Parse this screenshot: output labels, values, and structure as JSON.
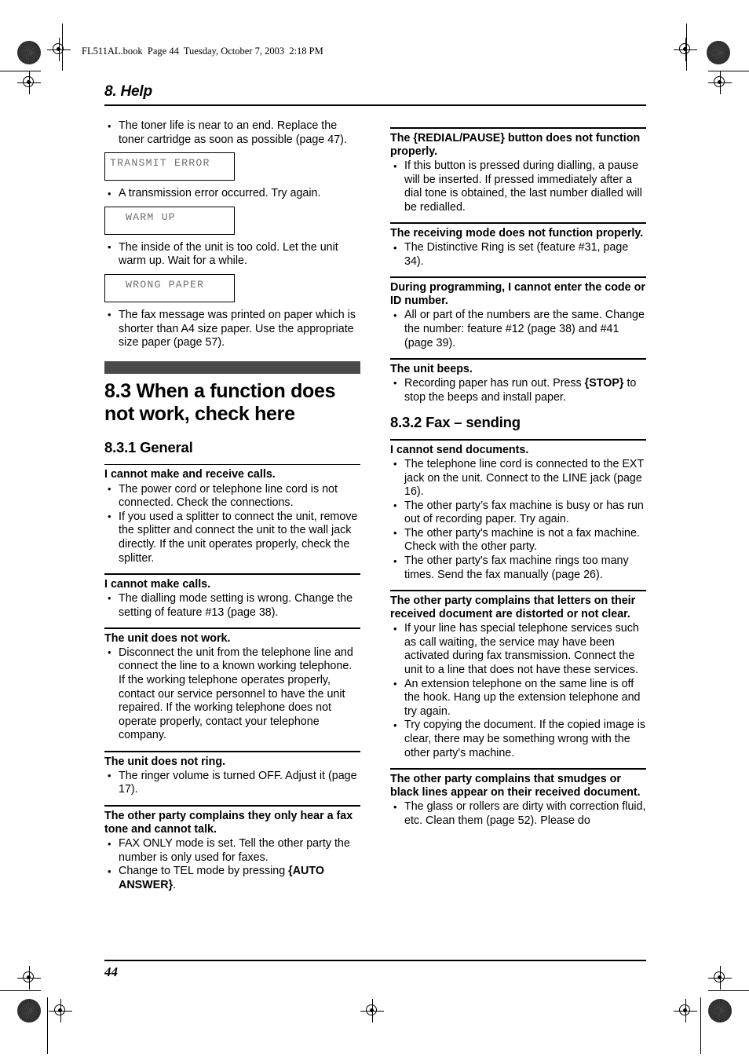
{
  "page": {
    "file_header": "FL511AL.book  Page 44  Tuesday, October 7, 2003  2:18 PM",
    "chapter_title": "8. Help",
    "page_number": "44"
  },
  "left_column": {
    "intro_bullets": [
      "The toner life is near to an end. Replace the toner cartridge as soon as possible (page 47)."
    ],
    "lcd_blocks": [
      {
        "display": "TRANSMIT ERROR",
        "align": "flush",
        "bullets": [
          "A transmission error occurred. Try again."
        ]
      },
      {
        "display": "WARM UP",
        "align": "indent",
        "bullets": [
          "The inside of the unit is too cold. Let the unit warm up. Wait for a while."
        ]
      },
      {
        "display": "WRONG PAPER",
        "align": "indent",
        "bullets": [
          "The fax message was printed on paper which is shorter than A4 size paper. Use the appropriate size paper (page 57)."
        ]
      }
    ],
    "section_heading": "8.3 When a function does not work, check here",
    "subsection_heading": "8.3.1 General",
    "qa_items": [
      {
        "question": "I cannot make and receive calls.",
        "bullets": [
          "The power cord or telephone line cord is not connected. Check the connections.",
          "If you used a splitter to connect the unit, remove the splitter and connect the unit to the wall jack directly. If the unit operates properly, check the splitter."
        ]
      },
      {
        "question": "I cannot make calls.",
        "bullets": [
          "The dialling mode setting is wrong. Change the setting of feature #13 (page 38)."
        ]
      },
      {
        "question": "The unit does not work.",
        "bullets": [
          "Disconnect the unit from the telephone line and connect the line to a known working telephone. If the working telephone operates properly, contact our service personnel to have the unit repaired. If the working telephone does not operate properly, contact your telephone company."
        ]
      },
      {
        "question": "The unit does not ring.",
        "bullets": [
          "The ringer volume is turned OFF. Adjust it (page 17)."
        ]
      },
      {
        "question": "The other party complains they only hear a fax tone and cannot talk.",
        "bullets_html": [
          "FAX ONLY mode is set. Tell the other party the number is only used for faxes.",
          "Change to TEL mode by pressing <span class=\"key\">{AUTO ANSWER}</span>."
        ]
      }
    ]
  },
  "right_column": {
    "qa_items_top": [
      {
        "question_html": "The <span class=\"key\">{REDIAL/PAUSE}</span> button does not function properly.",
        "bullets": [
          "If this button is pressed during dialling, a pause will be inserted. If pressed immediately after a dial tone is obtained, the last number dialled will be redialled."
        ]
      },
      {
        "question": "The receiving mode does not function properly.",
        "bullets": [
          "The Distinctive Ring is set (feature #31, page 34)."
        ]
      },
      {
        "question": "During programming, I cannot enter the code or ID number.",
        "bullets": [
          "All or part of the numbers are the same. Change the number: feature #12 (page 38) and #41 (page 39)."
        ]
      },
      {
        "question": "The unit beeps.",
        "bullets_html": [
          "Recording paper has run out. Press <span class=\"key\">{STOP}</span> to stop the beeps and install paper."
        ]
      }
    ],
    "subsection_heading": "8.3.2 Fax – sending",
    "qa_items_bottom": [
      {
        "question": "I cannot send documents.",
        "bullets": [
          "The telephone line cord is connected to the EXT jack on the unit. Connect to the LINE jack (page 16).",
          "The other party’s fax machine is busy or has run out of recording paper. Try again.",
          "The other party's machine is not a fax machine. Check with the other party.",
          "The other party's fax machine rings too many times. Send the fax manually (page 26)."
        ]
      },
      {
        "question": "The other party complains that letters on their received document are distorted or not clear.",
        "bullets": [
          "If your line has special telephone services such as call waiting, the service may have been activated during fax transmission. Connect the unit to a line that does not have these services.",
          "An extension telephone on the same line is off the hook. Hang up the extension telephone and try again.",
          "Try copying the document. If the copied image is clear, there may be something wrong with the other party's machine."
        ]
      },
      {
        "question": "The other party complains that smudges or black lines appear on their received document.",
        "bullets": [
          "The glass or rollers are dirty with correction fluid, etc. Clean them (page 52). Please do"
        ]
      }
    ]
  },
  "colors": {
    "gray_bar": "#4a4a4a",
    "lcd_text": "#6e6e6e"
  }
}
